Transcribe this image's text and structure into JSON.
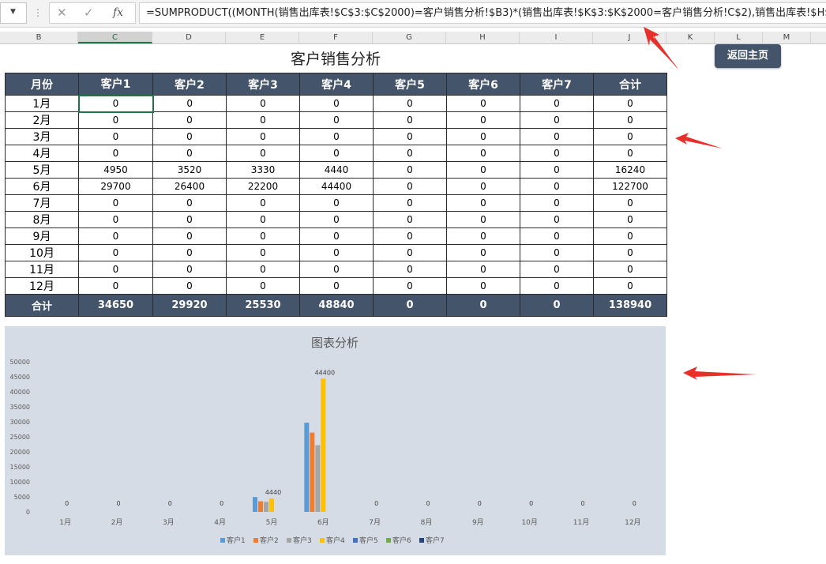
{
  "formula_bar": {
    "formula": "=SUMPRODUCT((MONTH(销售出库表!$C$3:$C$2000)=客户销售分析!$B3)*(销售出库表!$K$3:$K$2000=客户销售分析!C$2),销售出库表!$H$",
    "fx_label": "fx",
    "sep": "⋮",
    "cancel_icon": "✕",
    "enter_icon": "✓"
  },
  "column_headers": [
    "B",
    "C",
    "D",
    "E",
    "F",
    "G",
    "H",
    "I",
    "J",
    "K",
    "L",
    "M"
  ],
  "active_column": "C",
  "sheet": {
    "title": "客户销售分析",
    "home_button": "返回主页"
  },
  "table": {
    "headers": [
      "月份",
      "客户1",
      "客户2",
      "客户3",
      "客户4",
      "客户5",
      "客户6",
      "客户7",
      "合计"
    ],
    "rows": [
      {
        "month": "1月",
        "values": [
          "0",
          "0",
          "0",
          "0",
          "0",
          "0",
          "0",
          "0"
        ]
      },
      {
        "month": "2月",
        "values": [
          "0",
          "0",
          "0",
          "0",
          "0",
          "0",
          "0",
          "0"
        ]
      },
      {
        "month": "3月",
        "values": [
          "0",
          "0",
          "0",
          "0",
          "0",
          "0",
          "0",
          "0"
        ]
      },
      {
        "month": "4月",
        "values": [
          "0",
          "0",
          "0",
          "0",
          "0",
          "0",
          "0",
          "0"
        ]
      },
      {
        "month": "5月",
        "values": [
          "4950",
          "3520",
          "3330",
          "4440",
          "0",
          "0",
          "0",
          "16240"
        ]
      },
      {
        "month": "6月",
        "values": [
          "29700",
          "26400",
          "22200",
          "44400",
          "0",
          "0",
          "0",
          "122700"
        ]
      },
      {
        "month": "7月",
        "values": [
          "0",
          "0",
          "0",
          "0",
          "0",
          "0",
          "0",
          "0"
        ]
      },
      {
        "month": "8月",
        "values": [
          "0",
          "0",
          "0",
          "0",
          "0",
          "0",
          "0",
          "0"
        ]
      },
      {
        "month": "9月",
        "values": [
          "0",
          "0",
          "0",
          "0",
          "0",
          "0",
          "0",
          "0"
        ]
      },
      {
        "month": "10月",
        "values": [
          "0",
          "0",
          "0",
          "0",
          "0",
          "0",
          "0",
          "0"
        ]
      },
      {
        "month": "11月",
        "values": [
          "0",
          "0",
          "0",
          "0",
          "0",
          "0",
          "0",
          "0"
        ]
      },
      {
        "month": "12月",
        "values": [
          "0",
          "0",
          "0",
          "0",
          "0",
          "0",
          "0",
          "0"
        ]
      }
    ],
    "footer": {
      "label": "合计",
      "values": [
        "34650",
        "29920",
        "25530",
        "48840",
        "0",
        "0",
        "0",
        "138940"
      ]
    }
  },
  "colors": {
    "header_bg": "#44546a",
    "chart_bg": "#d6dce5",
    "arrow": "#e8302a",
    "series": [
      "#5b9bd5",
      "#ed7d31",
      "#a5a5a5",
      "#ffc000",
      "#4472c4",
      "#70ad47",
      "#264478"
    ]
  },
  "chart_data": {
    "type": "bar",
    "title": "图表分析",
    "categories": [
      "1月",
      "2月",
      "3月",
      "4月",
      "5月",
      "6月",
      "7月",
      "8月",
      "9月",
      "10月",
      "11月",
      "12月"
    ],
    "series": [
      {
        "name": "客户1",
        "values": [
          0,
          0,
          0,
          0,
          4950,
          29700,
          0,
          0,
          0,
          0,
          0,
          0
        ]
      },
      {
        "name": "客户2",
        "values": [
          0,
          0,
          0,
          0,
          3520,
          26400,
          0,
          0,
          0,
          0,
          0,
          0
        ]
      },
      {
        "name": "客户3",
        "values": [
          0,
          0,
          0,
          0,
          3330,
          22200,
          0,
          0,
          0,
          0,
          0,
          0
        ]
      },
      {
        "name": "客户4",
        "values": [
          0,
          0,
          0,
          0,
          4440,
          44400,
          0,
          0,
          0,
          0,
          0,
          0
        ]
      },
      {
        "name": "客户5",
        "values": [
          0,
          0,
          0,
          0,
          0,
          0,
          0,
          0,
          0,
          0,
          0,
          0
        ]
      },
      {
        "name": "客户6",
        "values": [
          0,
          0,
          0,
          0,
          0,
          0,
          0,
          0,
          0,
          0,
          0,
          0
        ]
      },
      {
        "name": "客户7",
        "values": [
          0,
          0,
          0,
          0,
          0,
          0,
          0,
          0,
          0,
          0,
          0,
          0
        ]
      }
    ],
    "y_ticks": [
      0,
      5000,
      10000,
      15000,
      20000,
      25000,
      30000,
      35000,
      40000,
      45000,
      50000
    ],
    "ylim": [
      0,
      50000
    ],
    "data_labels": [
      {
        "category": "1月",
        "text": "0"
      },
      {
        "category": "2月",
        "text": "0"
      },
      {
        "category": "3月",
        "text": "0"
      },
      {
        "category": "4月",
        "text": "0"
      },
      {
        "category": "5月",
        "text": "4440"
      },
      {
        "category": "6月",
        "text": "44400"
      },
      {
        "category": "7月",
        "text": "0"
      },
      {
        "category": "8月",
        "text": "0"
      },
      {
        "category": "9月",
        "text": "0"
      },
      {
        "category": "10月",
        "text": "0"
      },
      {
        "category": "11月",
        "text": "0"
      },
      {
        "category": "12月",
        "text": "0"
      }
    ],
    "legend_position": "bottom",
    "grid": false
  }
}
